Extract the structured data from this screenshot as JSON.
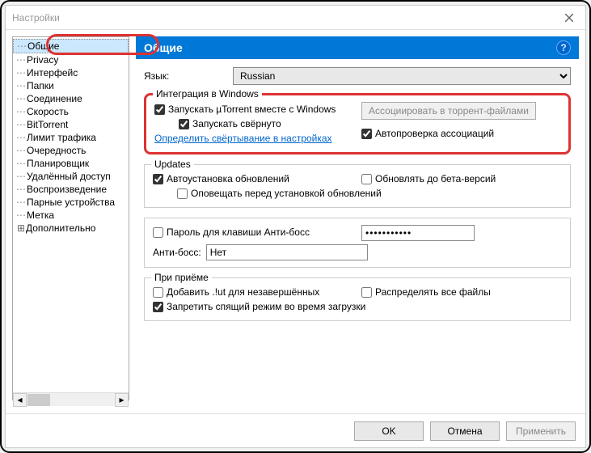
{
  "window": {
    "title": "Настройки"
  },
  "sidebar": {
    "items": [
      {
        "label": "Общие",
        "selected": true
      },
      {
        "label": "Privacy"
      },
      {
        "label": "Интерфейс"
      },
      {
        "label": "Папки"
      },
      {
        "label": "Соединение"
      },
      {
        "label": "Скорость"
      },
      {
        "label": "BitTorrent"
      },
      {
        "label": "Лимит трафика"
      },
      {
        "label": "Очередность"
      },
      {
        "label": "Планировщик"
      },
      {
        "label": "Удалённый доступ"
      },
      {
        "label": "Воспроизведение"
      },
      {
        "label": "Парные устройства"
      },
      {
        "label": "Метка"
      },
      {
        "label": "Дополнительно",
        "expandable": true
      }
    ]
  },
  "header": {
    "title": "Общие",
    "help": "?"
  },
  "lang": {
    "label": "Язык:",
    "value": "Russian"
  },
  "integration": {
    "legend": "Интеграция в Windows",
    "start_with_windows": "Запускать µTorrent вместе с Windows",
    "start_minimized": "Запускать свёрнуто",
    "override_minimize": "Определить свёртывание в настройках",
    "assoc_button": "Ассоциировать в торрент-файлами",
    "autocheck_assoc": "Автопроверка ассоциаций"
  },
  "updates": {
    "legend": "Updates",
    "auto_install": "Автоустановка обновлений",
    "update_beta": "Обновлять до бета-версий",
    "notify": "Оповещать перед установкой обновлений"
  },
  "boss": {
    "password_label": "Пароль для клавиши Анти-босс",
    "password_value": "•••••••••••",
    "hotkey_label": "Анти-босс:",
    "hotkey_value": "Нет"
  },
  "download": {
    "legend": "При приёме",
    "append_ut": "Добавить .!ut для незавершённых",
    "preallocate": "Распределять все файлы",
    "prevent_sleep": "Запретить спящий режим во время загрузки"
  },
  "footer": {
    "ok": "OK",
    "cancel": "Отмена",
    "apply": "Применить"
  }
}
